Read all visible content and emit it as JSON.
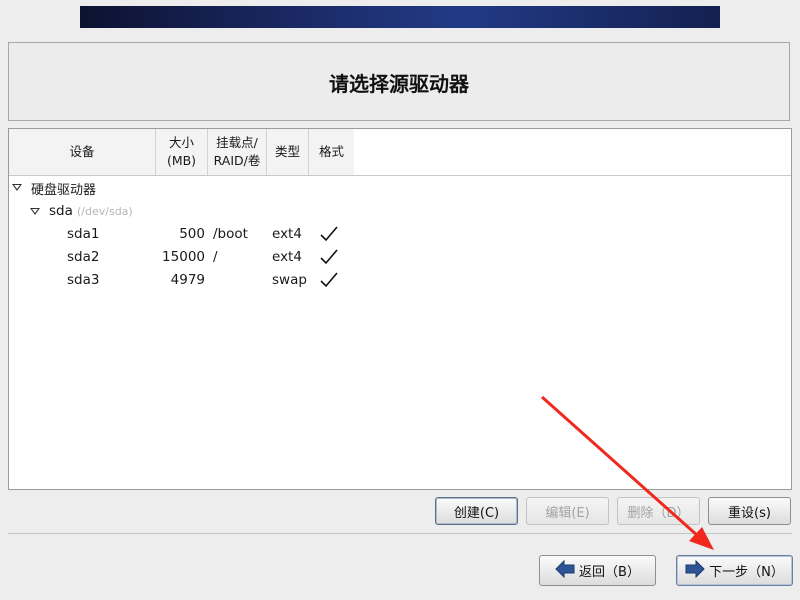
{
  "page": {
    "title": "请选择源驱动器"
  },
  "table": {
    "columns": {
      "device": "设备",
      "size_line1": "大小",
      "size_line2": "(MB)",
      "mount_line1": "挂载点/",
      "mount_line2": "RAID/卷",
      "type": "类型",
      "format": "格式"
    },
    "group": {
      "label": "硬盘驱动器"
    },
    "disk": {
      "name": "sda",
      "path": "(/dev/sda)"
    },
    "partitions": [
      {
        "device": "sda1",
        "size": "500",
        "mount": "/boot",
        "type": "ext4",
        "format_checked": true
      },
      {
        "device": "sda2",
        "size": "15000",
        "mount": "/",
        "type": "ext4",
        "format_checked": true
      },
      {
        "device": "sda3",
        "size": "4979",
        "mount": "",
        "type": "swap",
        "format_checked": true
      }
    ]
  },
  "actions": {
    "create": "创建(C)",
    "edit": "编辑(E)",
    "delete": "删除（D）",
    "reset": "重设(s)"
  },
  "nav": {
    "back": "返回（B）",
    "next": "下一步（N）"
  },
  "colors": {
    "banner": "#1b2a66",
    "nav_arrow": "#2f5597",
    "annotation_arrow": "#f0281e"
  }
}
